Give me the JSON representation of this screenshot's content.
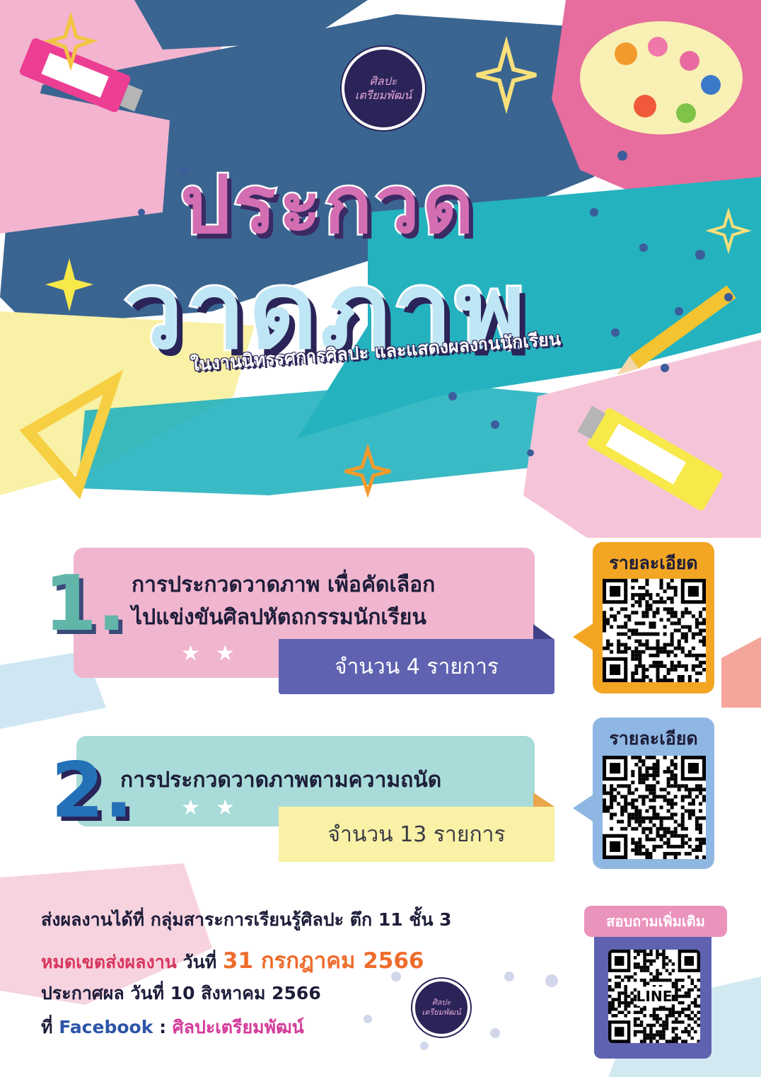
{
  "logo": {
    "text_line_1": "ศิลปะ",
    "text_line_2": "เตรียมพัฒน์"
  },
  "title": {
    "line_1": "ประกวด",
    "line_2": "วาดภาพ"
  },
  "subtitle": "ในงานนิทรรศการศิลปะ และแสดงผลงานนักเรียน",
  "items": [
    {
      "number": "1.",
      "title_line_1": "การประกวดวาดภาพ เพื่อคัดเลือก",
      "title_line_2": "ไปแข่งขันศิลปหัตถกรรมนักเรียน",
      "count": "จำนวน 4 รายการ",
      "qr_label": "รายละเอียด"
    },
    {
      "number": "2.",
      "title_line_1": "การประกวดวาดภาพตามความถนัด",
      "count": "จำนวน 13 รายการ",
      "qr_label": "รายละเอียด"
    }
  ],
  "info": {
    "submit": "ส่งผลงานได้ที่ กลุ่มสาระการเรียนรู้ศิลปะ ตึก 11 ชั้น 3",
    "deadline_label": "หมดเขตส่งผลงาน",
    "deadline_mid": "วันที่",
    "deadline_date": "31 กรกฎาคม 2566",
    "announce": "ประกาศผล วันที่ 10 สิงหาคม 2566",
    "facebook_prefix": "ที่",
    "facebook_label": "Facebook",
    "facebook_sep": ":",
    "facebook_page": "ศิลปะเตรียมพัฒน์"
  },
  "contact": {
    "label": "สอบถามเพิ่มเติม",
    "qr_center": "LINE"
  },
  "colors": {
    "navy": "#2a2458",
    "pink": "#f1b6cf",
    "teal": "#a9dcd8",
    "violet": "#5f62b0",
    "orange": "#f3a623",
    "sky": "#8fb7e3"
  }
}
